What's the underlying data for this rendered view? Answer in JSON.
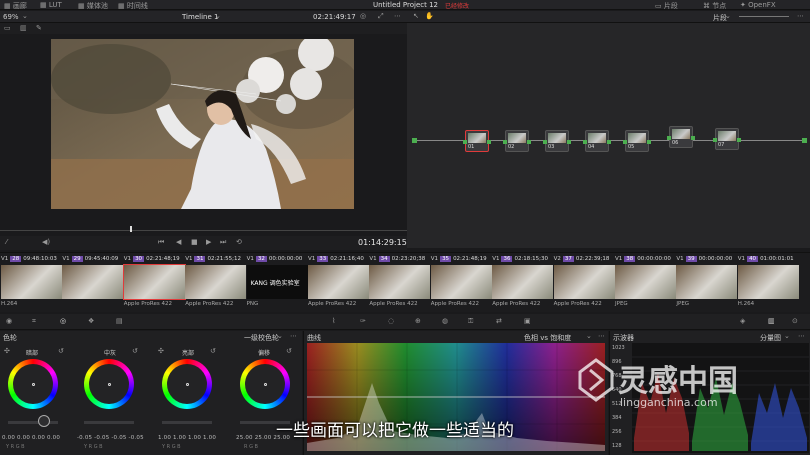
{
  "topbar": {
    "tabs": [
      "画廊",
      "LUT",
      "媒体池",
      "时间线"
    ],
    "project_title": "Untitled Project 12",
    "project_status": "已经修改",
    "right_items": [
      "片段",
      "节点",
      "OpenFX"
    ]
  },
  "viewer": {
    "zoom": "69%",
    "timeline_name": "Timeline 1",
    "source_timecode": "02:21:49:17",
    "playhead_timecode": "01:14:29:15"
  },
  "node_editor": {
    "mode_label": "片段",
    "nodes": [
      "01",
      "02",
      "03",
      "04",
      "05",
      "06",
      "07"
    ]
  },
  "clips": [
    {
      "track": "V1",
      "num": "28",
      "tc": "09:48:10:03",
      "codec": "H.264"
    },
    {
      "track": "V1",
      "num": "29",
      "tc": "09:45:40:09",
      "codec": ""
    },
    {
      "track": "V1",
      "num": "30",
      "tc": "02:21:48;19",
      "codec": "Apple ProRes 422"
    },
    {
      "track": "V1",
      "num": "31",
      "tc": "02:21:55;12",
      "codec": "Apple ProRes 422"
    },
    {
      "track": "V1",
      "num": "32",
      "tc": "00:00:00:00",
      "codec": "PNG"
    },
    {
      "track": "V1",
      "num": "33",
      "tc": "02:21:16;40",
      "codec": "Apple ProRes 422"
    },
    {
      "track": "V1",
      "num": "34",
      "tc": "02:23:20;38",
      "codec": "Apple ProRes 422"
    },
    {
      "track": "V1",
      "num": "35",
      "tc": "02:21:48;19",
      "codec": "Apple ProRes 422"
    },
    {
      "track": "V1",
      "num": "36",
      "tc": "02:18:15;30",
      "codec": "Apple ProRes 422"
    },
    {
      "track": "V2",
      "num": "37",
      "tc": "02:22:39;18",
      "codec": "Apple ProRes 422"
    },
    {
      "track": "V1",
      "num": "38",
      "tc": "00:00:00:00",
      "codec": "JPEG"
    },
    {
      "track": "V1",
      "num": "39",
      "tc": "00:00:00:00",
      "codec": "JPEG"
    },
    {
      "track": "V1",
      "num": "40",
      "tc": "01:00:01:01",
      "codec": "H.264"
    }
  ],
  "png_clip_text": "KANG 调色实验室",
  "color_panel": {
    "title": "色轮",
    "mode": "一级校色轮",
    "wheels": [
      {
        "label": "暗部",
        "values": "0.00  0.00  0.00  0.00",
        "channels": "Y   R   G   B"
      },
      {
        "label": "中灰",
        "values": "-0.05  -0.05  -0.05  -0.05",
        "channels": "Y   R   G   B"
      },
      {
        "label": "亮部",
        "values": "1.00  1.00  1.00  1.00",
        "channels": "Y   R   G   B"
      },
      {
        "label": "偏移",
        "values": "25.00  25.00  25.00",
        "channels": "R   G   B"
      }
    ]
  },
  "curves_panel": {
    "title": "曲线",
    "mode": "色相 vs 饱和度"
  },
  "scope_panel": {
    "title": "示波器",
    "mode": "分量图",
    "scale": [
      "1023",
      "896",
      "768",
      "640",
      "512",
      "384",
      "256",
      "128"
    ]
  },
  "subtitle": "一些画面可以把它做一些适当的",
  "watermark": {
    "brand": "灵感中国",
    "url": "lingganchina.com"
  },
  "colors": {
    "accent_red": "#e03b3b",
    "clip_num_purple": "#6f4ba8",
    "node_green": "#4caf50"
  }
}
